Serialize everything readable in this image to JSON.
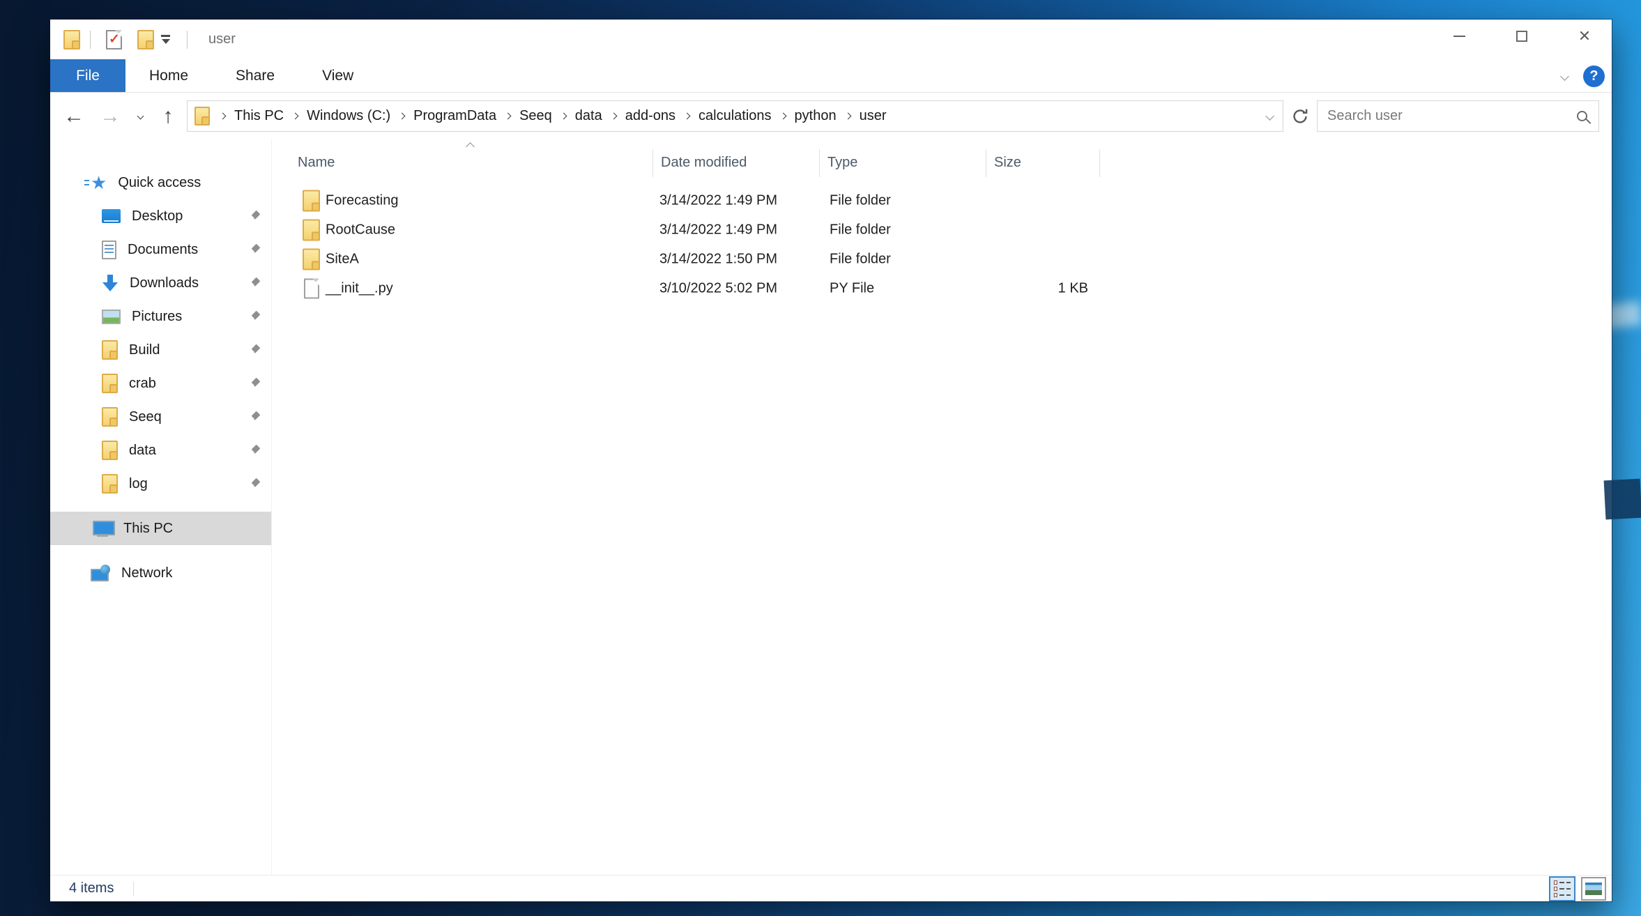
{
  "titlebar": {
    "title": "user"
  },
  "ribbon": {
    "tabs": [
      {
        "label": "File",
        "active": true
      },
      {
        "label": "Home",
        "active": false
      },
      {
        "label": "Share",
        "active": false
      },
      {
        "label": "View",
        "active": false
      }
    ]
  },
  "address_bar": {
    "breadcrumb": [
      "This PC",
      "Windows (C:)",
      "ProgramData",
      "Seeq",
      "data",
      "add-ons",
      "calculations",
      "python",
      "user"
    ],
    "search_placeholder": "Search user"
  },
  "sidebar": {
    "quick_access": {
      "label": "Quick access"
    },
    "pinned_items": [
      {
        "label": "Desktop",
        "icon": "desktop-icon",
        "pinned": true
      },
      {
        "label": "Documents",
        "icon": "documents-icon",
        "pinned": true
      },
      {
        "label": "Downloads",
        "icon": "downloads-icon",
        "pinned": true
      },
      {
        "label": "Pictures",
        "icon": "pictures-icon",
        "pinned": true
      },
      {
        "label": "Build",
        "icon": "folder-icon",
        "pinned": true
      },
      {
        "label": "crab",
        "icon": "folder-icon",
        "pinned": true
      },
      {
        "label": "Seeq",
        "icon": "folder-icon",
        "pinned": true
      },
      {
        "label": "data",
        "icon": "folder-icon",
        "pinned": true
      },
      {
        "label": "log",
        "icon": "folder-icon",
        "pinned": true
      }
    ],
    "this_pc": {
      "label": "This PC",
      "selected": true
    },
    "network": {
      "label": "Network"
    }
  },
  "file_list": {
    "columns": [
      {
        "label": "Name"
      },
      {
        "label": "Date modified"
      },
      {
        "label": "Type"
      },
      {
        "label": "Size"
      }
    ],
    "sort": {
      "column": "Name",
      "direction": "ascending"
    },
    "rows": [
      {
        "name": "Forecasting",
        "date_modified": "3/14/2022 1:49 PM",
        "type": "File folder",
        "size": "",
        "icon": "folder-icon"
      },
      {
        "name": "RootCause",
        "date_modified": "3/14/2022 1:49 PM",
        "type": "File folder",
        "size": "",
        "icon": "folder-icon"
      },
      {
        "name": "SiteA",
        "date_modified": "3/14/2022 1:50 PM",
        "type": "File folder",
        "size": "",
        "icon": "folder-icon"
      },
      {
        "name": "__init__.py",
        "date_modified": "3/10/2022 5:02 PM",
        "type": "PY File",
        "size": "1 KB",
        "icon": "python-file-icon"
      }
    ]
  },
  "status_bar": {
    "items_count": "4 items"
  },
  "colors": {
    "active_tab_blue": "#2a73c5",
    "folder_yellow": "#f4d170",
    "selection_gray": "#d9d9d9",
    "help_blue": "#1e6fd0",
    "status_text": "#223c61"
  }
}
